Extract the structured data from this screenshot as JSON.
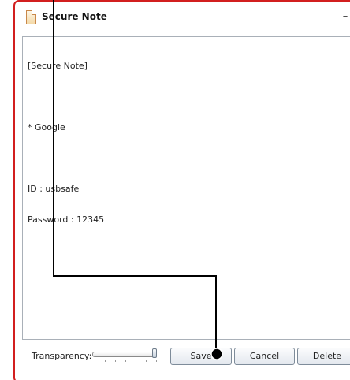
{
  "window": {
    "title": "Secure Note",
    "minimize_glyph": "–",
    "icon": "note-icon"
  },
  "editor": {
    "lines": [
      "[Secure Note]",
      "",
      "* Google",
      "",
      "ID : usbsafe",
      "Password : 12345"
    ]
  },
  "bottom": {
    "transparency_label": "Transparency:",
    "transparency_level": 1.0,
    "save_label": "Save",
    "cancel_label": "Cancel",
    "delete_label": "Delete"
  },
  "colors": {
    "window_border": "#d21f1f",
    "annotation": "#000000"
  }
}
